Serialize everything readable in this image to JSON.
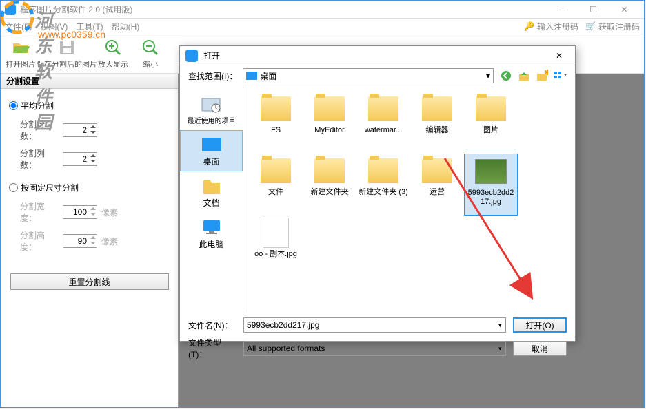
{
  "watermark": {
    "title": "河东软件园",
    "url": "www.pc0359.cn"
  },
  "window": {
    "title": "程序图片分割软件 2.0 (试用版)",
    "menus": {
      "file": "文件(F)",
      "view": "视图(V)",
      "tool": "工具(T)",
      "help": "帮助(H)"
    },
    "reg": {
      "input": "输入注册码",
      "get": "获取注册码"
    },
    "toolbar": {
      "open": "打开图片",
      "save": "保存分割后的图片",
      "zoomIn": "放大显示",
      "zoomOut": "缩小"
    }
  },
  "sidebar": {
    "title": "分割设置",
    "avg": {
      "label": "平均分割",
      "rows": "分割行数：",
      "rowsVal": "2",
      "cols": "分割列数：",
      "colsVal": "2"
    },
    "fixed": {
      "label": "按固定尺寸分割",
      "w": "分割宽度：",
      "wVal": "100",
      "h": "分割高度：",
      "hVal": "90",
      "unit": "像素"
    },
    "reset": "重置分割线"
  },
  "dialog": {
    "title": "打开",
    "lookIn": "查找范围(I)：",
    "path": "桌面",
    "places": {
      "recent": "最近使用的项目",
      "desktop": "桌面",
      "docs": "文档",
      "pc": "此电脑"
    },
    "files": [
      {
        "name": "FS",
        "type": "folder"
      },
      {
        "name": "MyEditor",
        "type": "folder"
      },
      {
        "name": "watermar...",
        "type": "folder"
      },
      {
        "name": "编辑器",
        "type": "folder"
      },
      {
        "name": "图片",
        "type": "folder"
      },
      {
        "name": "文件",
        "type": "folder"
      },
      {
        "name": "新建文件夹",
        "type": "folder"
      },
      {
        "name": "新建文件夹 (3)",
        "type": "folder"
      },
      {
        "name": "运营",
        "type": "folder"
      },
      {
        "name": "5993ecb2dd217.jpg",
        "type": "image",
        "selected": true
      },
      {
        "name": "oo - 副本.jpg",
        "type": "doc"
      }
    ],
    "fileName": {
      "label": "文件名(N)：",
      "value": "5993ecb2dd217.jpg"
    },
    "fileType": {
      "label": "文件类型(T)：",
      "value": "All supported formats"
    },
    "openBtn": "打开(O)",
    "cancelBtn": "取消"
  }
}
